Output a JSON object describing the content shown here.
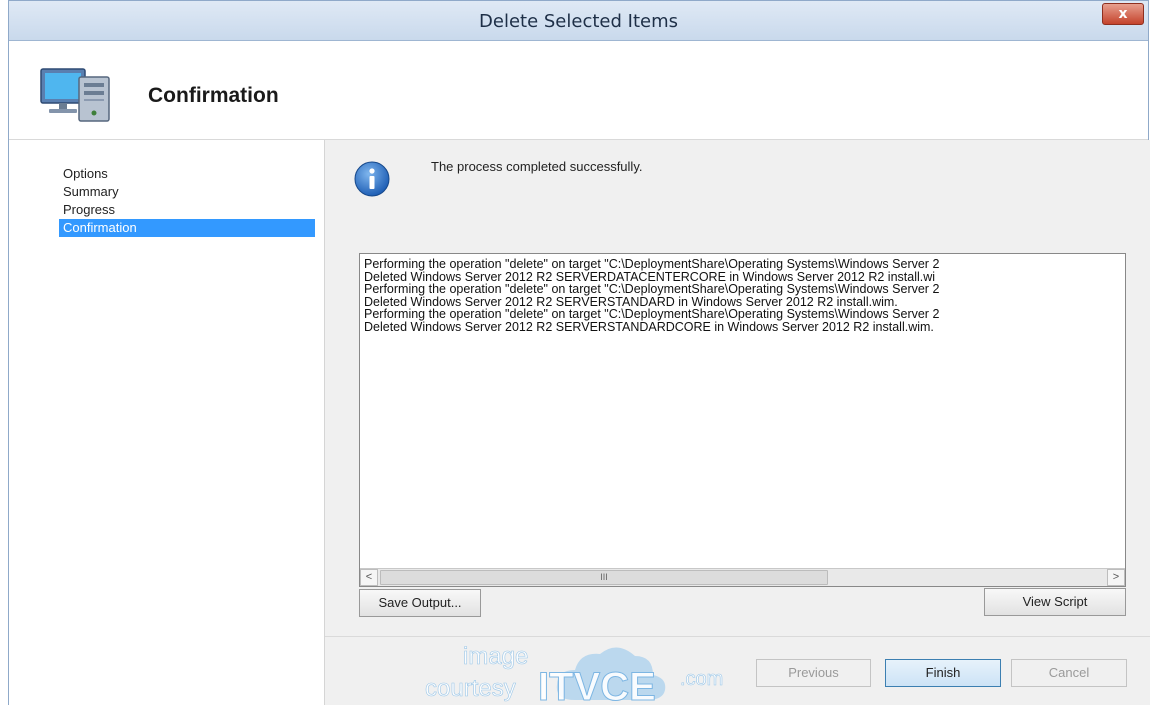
{
  "window": {
    "title": "Delete Selected Items",
    "close_label": "x"
  },
  "header": {
    "title": "Confirmation",
    "icon": "computer-icon"
  },
  "sidebar": {
    "items": [
      {
        "label": "Options"
      },
      {
        "label": "Summary"
      },
      {
        "label": "Progress"
      },
      {
        "label": "Confirmation"
      }
    ],
    "selected": "Confirmation",
    "selected_color": "#3399ff"
  },
  "main": {
    "status_icon": "info-icon",
    "status_text": "The process completed successfully.",
    "output_lines": [
      "Performing the operation \"delete\" on target \"C:\\DeploymentShare\\Operating Systems\\Windows Server 2",
      "Deleted Windows Server 2012 R2 SERVERDATACENTERCORE in Windows Server 2012 R2 install.wi",
      "Performing the operation \"delete\" on target \"C:\\DeploymentShare\\Operating Systems\\Windows Server 2",
      "Deleted Windows Server 2012 R2 SERVERSTANDARD in Windows Server 2012 R2 install.wim.",
      "Performing the operation \"delete\" on target \"C:\\DeploymentShare\\Operating Systems\\Windows Server 2",
      "Deleted Windows Server 2012 R2 SERVERSTANDARDCORE in Windows Server 2012 R2 install.wim."
    ],
    "scroll_left": "<",
    "scroll_right": ">",
    "scroll_thumb": "III",
    "save_output_label": "Save Output...",
    "view_script_label": "View Script"
  },
  "footer": {
    "previous_label": "Previous",
    "finish_label": "Finish",
    "cancel_label": "Cancel"
  },
  "watermark": {
    "line1": "image",
    "line2": "courtesy",
    "brand": "ITVCE",
    "suffix": ".com"
  },
  "colors": {
    "accent": "#3399ff",
    "info_blue": "#1f5fb5",
    "close_red": "#c4432c"
  }
}
